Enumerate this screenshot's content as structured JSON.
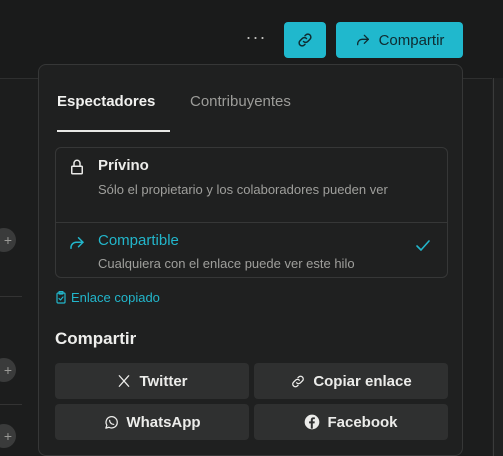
{
  "topbar": {
    "more_label": "···",
    "share_label": "Compartir",
    "accent_color": "#20b8cd"
  },
  "popover": {
    "tabs": [
      {
        "label": "Espectadores",
        "active": true
      },
      {
        "label": "Contribuyentes",
        "active": false
      }
    ],
    "options": [
      {
        "icon": "lock-icon",
        "title": "Prívino",
        "description": "Sólo el propietario y los colaboradores pueden ver",
        "selected": false
      },
      {
        "icon": "share-arrow-icon",
        "title": "Compartible",
        "description": "Cualquiera con el enlace puede ver este hilo",
        "selected": true
      }
    ],
    "copied_text": "Enlace copiado",
    "share_heading": "Compartir",
    "share_buttons": [
      {
        "icon": "x-icon",
        "label": "Twitter"
      },
      {
        "icon": "link-icon",
        "label": "Copiar enlace"
      },
      {
        "icon": "whatsapp-icon",
        "label": "WhatsApp"
      },
      {
        "icon": "facebook-icon",
        "label": "Facebook"
      }
    ]
  }
}
